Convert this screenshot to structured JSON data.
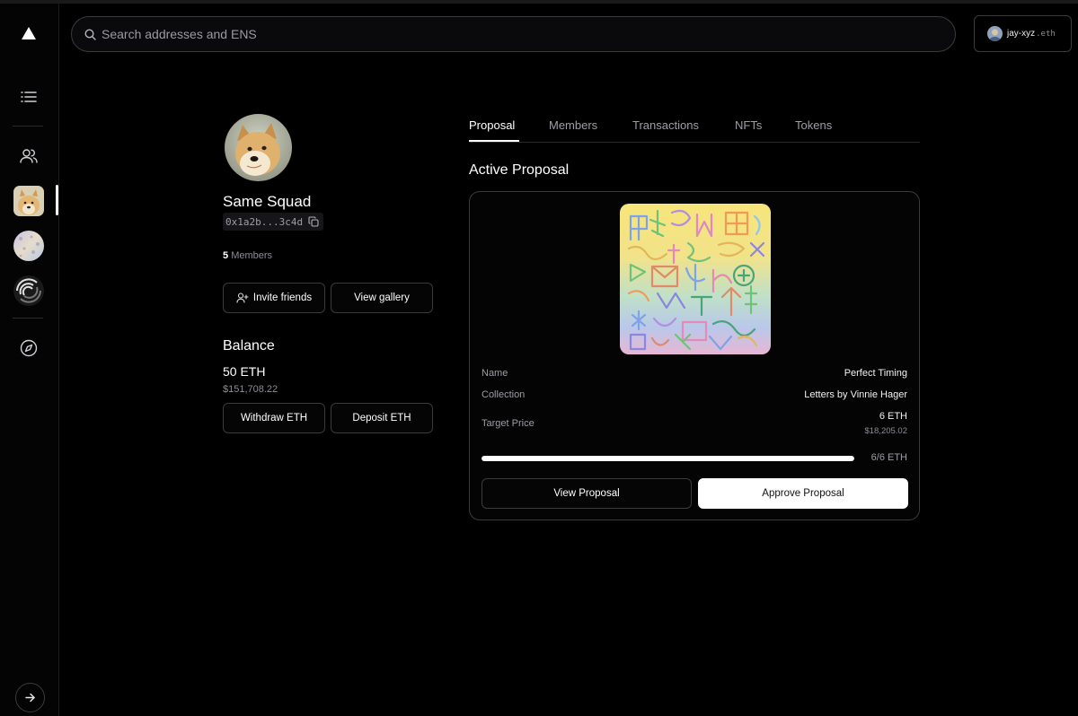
{
  "search": {
    "placeholder": "Search addresses and ENS"
  },
  "account": {
    "name": "jay-xyz",
    "suffix": ".eth"
  },
  "sidebar": {
    "items": [
      {
        "name": "logo",
        "icon": "triangle-logo-icon"
      },
      {
        "name": "feed",
        "icon": "list-icon"
      },
      {
        "name": "squads",
        "icon": "users-icon"
      },
      {
        "name": "squad-same",
        "icon": "doge-avatar"
      },
      {
        "name": "squad-holo",
        "icon": "holo-avatar"
      },
      {
        "name": "squad-swirl",
        "icon": "swirl-avatar"
      },
      {
        "name": "explore",
        "icon": "compass-icon"
      }
    ],
    "bottom": {
      "icon": "arrow-right-icon"
    }
  },
  "group": {
    "name": "Same Squad",
    "address": "0x1a2b...3c4d",
    "members_count": "5",
    "members_label": "Members",
    "invite_label": "Invite friends",
    "gallery_label": "View gallery"
  },
  "balance": {
    "title": "Balance",
    "eth": "50 ETH",
    "usd": "$151,708.22",
    "withdraw_label": "Withdraw ETH",
    "deposit_label": "Deposit ETH"
  },
  "tabs": [
    {
      "label": "Proposal",
      "active": true
    },
    {
      "label": "Members",
      "active": false
    },
    {
      "label": "Transactions",
      "active": false
    },
    {
      "label": "NFTs",
      "active": false
    },
    {
      "label": "Tokens",
      "active": false
    }
  ],
  "proposal": {
    "section_title": "Active Proposal",
    "rows": {
      "name_label": "Name",
      "name_value": "Perfect Timing",
      "collection_label": "Collection",
      "collection_value": "Letters by Vinnie Hager",
      "price_label": "Target Price",
      "price_value": "6 ETH",
      "price_usd": "$18,205.02"
    },
    "progress": {
      "text": "6/6 ETH",
      "fraction": 1.0
    },
    "view_label": "View Proposal",
    "approve_label": "Approve Proposal"
  },
  "colors": {
    "background": "#000000",
    "border": "#3a3a3f",
    "muted_text": "#9d9da6",
    "primary_button": "#ffffff"
  }
}
